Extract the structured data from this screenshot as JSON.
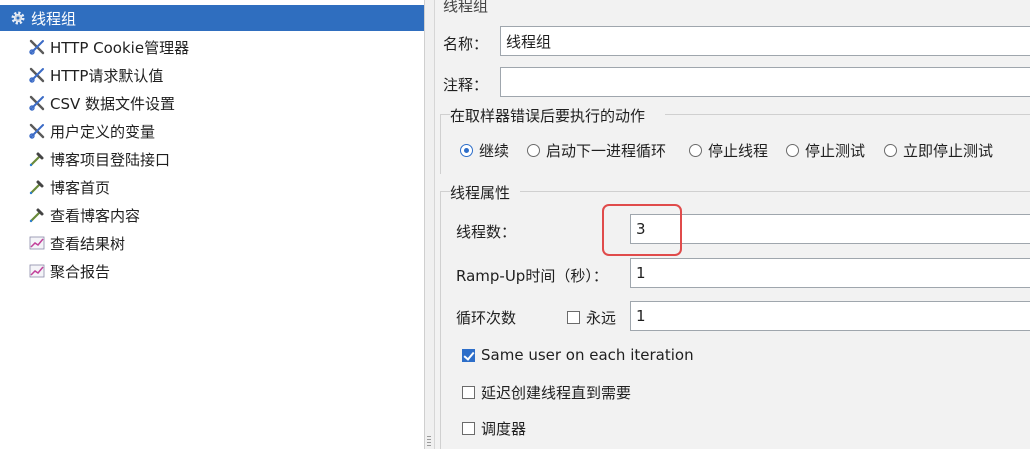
{
  "tree": {
    "selected": "线程组",
    "items": [
      {
        "label": "HTTP Cookie管理器",
        "icon": "wrench-scissors-icon"
      },
      {
        "label": "HTTP请求默认值",
        "icon": "wrench-scissors-icon"
      },
      {
        "label": "CSV 数据文件设置",
        "icon": "wrench-scissors-icon"
      },
      {
        "label": "用户定义的变量",
        "icon": "wrench-scissors-icon"
      },
      {
        "label": "博客项目登陆接口",
        "icon": "pipette-icon"
      },
      {
        "label": "博客首页",
        "icon": "pipette-icon"
      },
      {
        "label": "查看博客内容",
        "icon": "pipette-icon"
      },
      {
        "label": "查看结果树",
        "icon": "graph-icon"
      },
      {
        "label": "聚合报告",
        "icon": "graph-icon"
      }
    ]
  },
  "form": {
    "title": "线程组",
    "name_label": "名称：",
    "name_value": "线程组",
    "comment_label": "注释：",
    "comment_value": "",
    "error_group_title": "在取样器错误后要执行的动作",
    "error_actions": [
      "继续",
      "启动下一进程循环",
      "停止线程",
      "停止测试",
      "立即停止测试"
    ],
    "error_action_selected": 0,
    "thread_props_title": "线程属性",
    "threads_label": "线程数：",
    "threads_value": "3",
    "rampup_label": "Ramp-Up时间（秒）：",
    "rampup_value": "1",
    "loop_label": "循环次数",
    "loop_forever_label": "永远",
    "loop_forever_checked": false,
    "loop_value": "1",
    "same_user_label": "Same user on each iteration",
    "same_user_checked": true,
    "delay_create_label": "延迟创建线程直到需要",
    "delay_create_checked": false,
    "scheduler_label": "调度器",
    "scheduler_checked": false
  },
  "colors": {
    "selection": "#2f6ebf",
    "accent": "#2d6ec9",
    "annotation": "#e04b4b"
  }
}
